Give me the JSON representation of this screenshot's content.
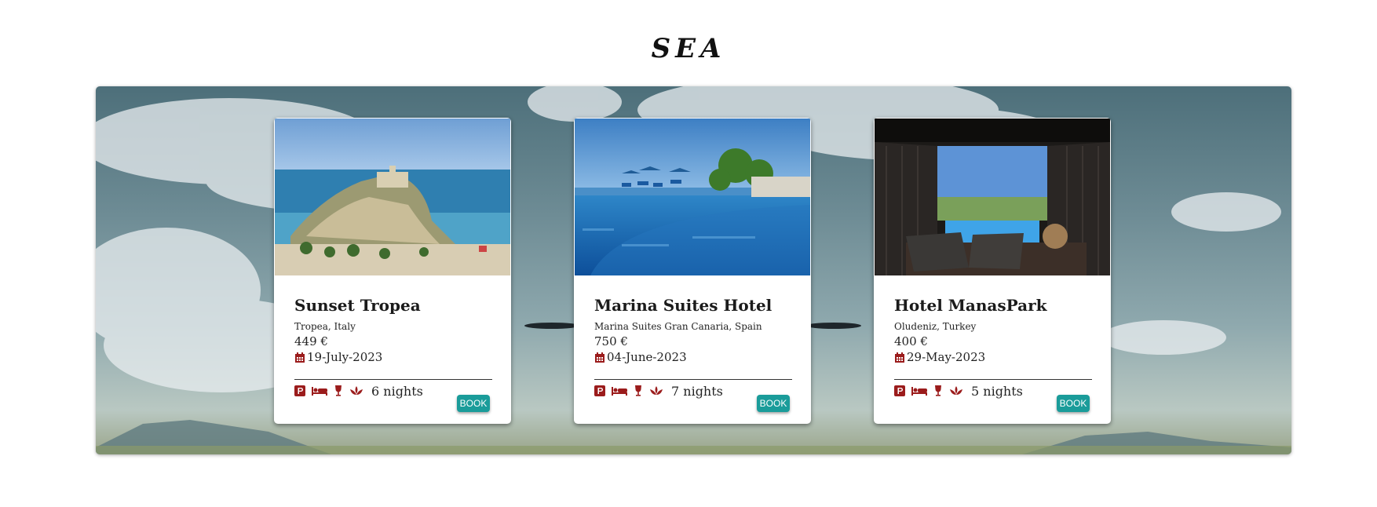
{
  "page": {
    "heading": "SEA"
  },
  "colors": {
    "accent": "#1a9c9a",
    "icon": "#9b1c1c"
  },
  "cards": [
    {
      "title": "Sunset Tropea",
      "location": "Tropea, Italy",
      "price": "449 €",
      "date": "19-July-2023",
      "nights": "6 nights",
      "book_label": "BOOK",
      "image": "tropea-island-monastery-photo",
      "amenity_icons": [
        "parking-icon",
        "bed-icon",
        "wine-glass-icon",
        "spa-lotus-icon"
      ]
    },
    {
      "title": "Marina Suites Hotel",
      "location": "Marina Suites Gran Canaria, Spain",
      "price": "750 €",
      "date": "04-June-2023",
      "nights": "7 nights",
      "book_label": "BOOK",
      "image": "infinity-pool-photo",
      "amenity_icons": [
        "parking-icon",
        "bed-icon",
        "wine-glass-icon",
        "spa-lotus-icon"
      ]
    },
    {
      "title": "Hotel ManasPark",
      "location": "Oludeniz, Turkey",
      "price": "400 €",
      "date": "29-May-2023",
      "nights": "5 nights",
      "book_label": "BOOK",
      "image": "private-pool-terrace-photo",
      "amenity_icons": [
        "parking-icon",
        "bed-icon",
        "wine-glass-icon",
        "spa-lotus-icon"
      ]
    }
  ]
}
